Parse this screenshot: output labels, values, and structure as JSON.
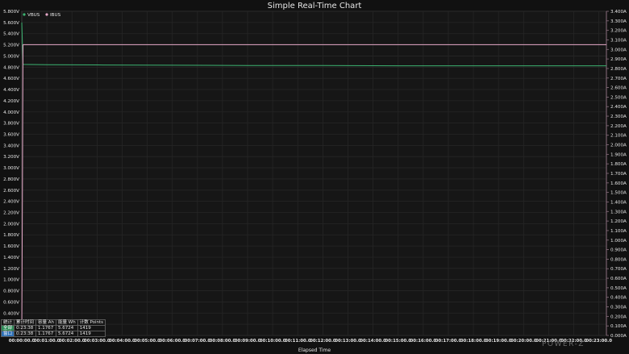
{
  "chart_data": {
    "type": "line",
    "title": "Simple Real-Time Chart",
    "xlabel": "Elapsed Time",
    "ylabel_left": "",
    "ylabel_right": "",
    "x_ticks": [
      "00:00:00.0",
      "00:01:00.0",
      "00:02:00.0",
      "00:03:00.0",
      "00:04:00.0",
      "00:05:00.0",
      "00:06:00.0",
      "00:07:00.0",
      "00:08:00.0",
      "00:09:00.0",
      "00:10:00.0",
      "00:11:00.0",
      "00:12:00.0",
      "00:13:00.0",
      "00:14:00.0",
      "00:15:00.0",
      "00:16:00.0",
      "00:17:00.0",
      "00:18:00.0",
      "00:19:00.0",
      "00:20:00.0",
      "00:21:00.0",
      "00:22:00.0",
      "00:23:00.0"
    ],
    "xlim_minutes": [
      0,
      23.3
    ],
    "y_left": {
      "min": 0,
      "max": 5.8,
      "step": 0.2,
      "unit": "V",
      "decimals": 3,
      "tick_labels": [
        "0.000V",
        "0.200V",
        "0.400V",
        "0.600V",
        "0.800V",
        "1.000V",
        "1.200V",
        "1.400V",
        "1.600V",
        "1.800V",
        "2.000V",
        "2.200V",
        "2.400V",
        "2.600V",
        "2.800V",
        "3.000V",
        "3.200V",
        "3.400V",
        "3.600V",
        "3.800V",
        "4.000V",
        "4.200V",
        "4.400V",
        "4.600V",
        "4.800V",
        "5.000V",
        "5.200V",
        "5.400V",
        "5.600V",
        "5.800V"
      ]
    },
    "y_right": {
      "min": 0,
      "max": 3.4,
      "step": 0.1,
      "unit": "A",
      "decimals": 3,
      "tick_labels": [
        "0.000A",
        "0.100A",
        "0.200A",
        "0.300A",
        "0.400A",
        "0.500A",
        "0.600A",
        "0.700A",
        "0.800A",
        "0.900A",
        "1.000A",
        "1.100A",
        "1.200A",
        "1.300A",
        "1.400A",
        "1.500A",
        "1.600A",
        "1.700A",
        "1.800A",
        "1.900A",
        "2.000A",
        "2.100A",
        "2.200A",
        "2.300A",
        "2.400A",
        "2.500A",
        "2.600A",
        "2.700A",
        "2.800A",
        "2.900A",
        "3.000A",
        "3.100A",
        "3.200A",
        "3.300A",
        "3.400A"
      ]
    },
    "grid": true,
    "legend_position": "top-left",
    "series": [
      {
        "name": "VBUS",
        "axis": "left",
        "color": "#3cb371",
        "x": [
          0,
          0.05,
          1,
          3,
          6,
          9,
          12,
          15,
          18,
          21,
          23.3
        ],
        "y": [
          5.6,
          4.85,
          4.845,
          4.84,
          4.835,
          4.83,
          4.83,
          4.825,
          4.825,
          4.825,
          4.825
        ]
      },
      {
        "name": "IBUS",
        "axis": "right",
        "color": "#e6a8c8",
        "x": [
          0,
          0.05,
          1,
          5,
          10,
          15,
          20,
          23.3
        ],
        "y": [
          0.0,
          3.05,
          3.05,
          3.05,
          3.05,
          3.05,
          3.05,
          3.05
        ]
      }
    ]
  },
  "stats_table": {
    "header": [
      "统计",
      "累计时间",
      "容量 Ah",
      "能量 Wh",
      "计数 Points"
    ],
    "rows": [
      {
        "tag": "全部",
        "time": "0:23:38",
        "ah": "1.1767",
        "wh": "5.6724",
        "points": "1419"
      },
      {
        "tag": "窗口",
        "time": "0:23:38",
        "ah": "1.1767",
        "wh": "5.6724",
        "points": "1419"
      }
    ]
  },
  "logo": "POWER-Z",
  "colors": {
    "background": "#111111",
    "grid": "#2a2a2a",
    "text": "#e6e6e6"
  }
}
